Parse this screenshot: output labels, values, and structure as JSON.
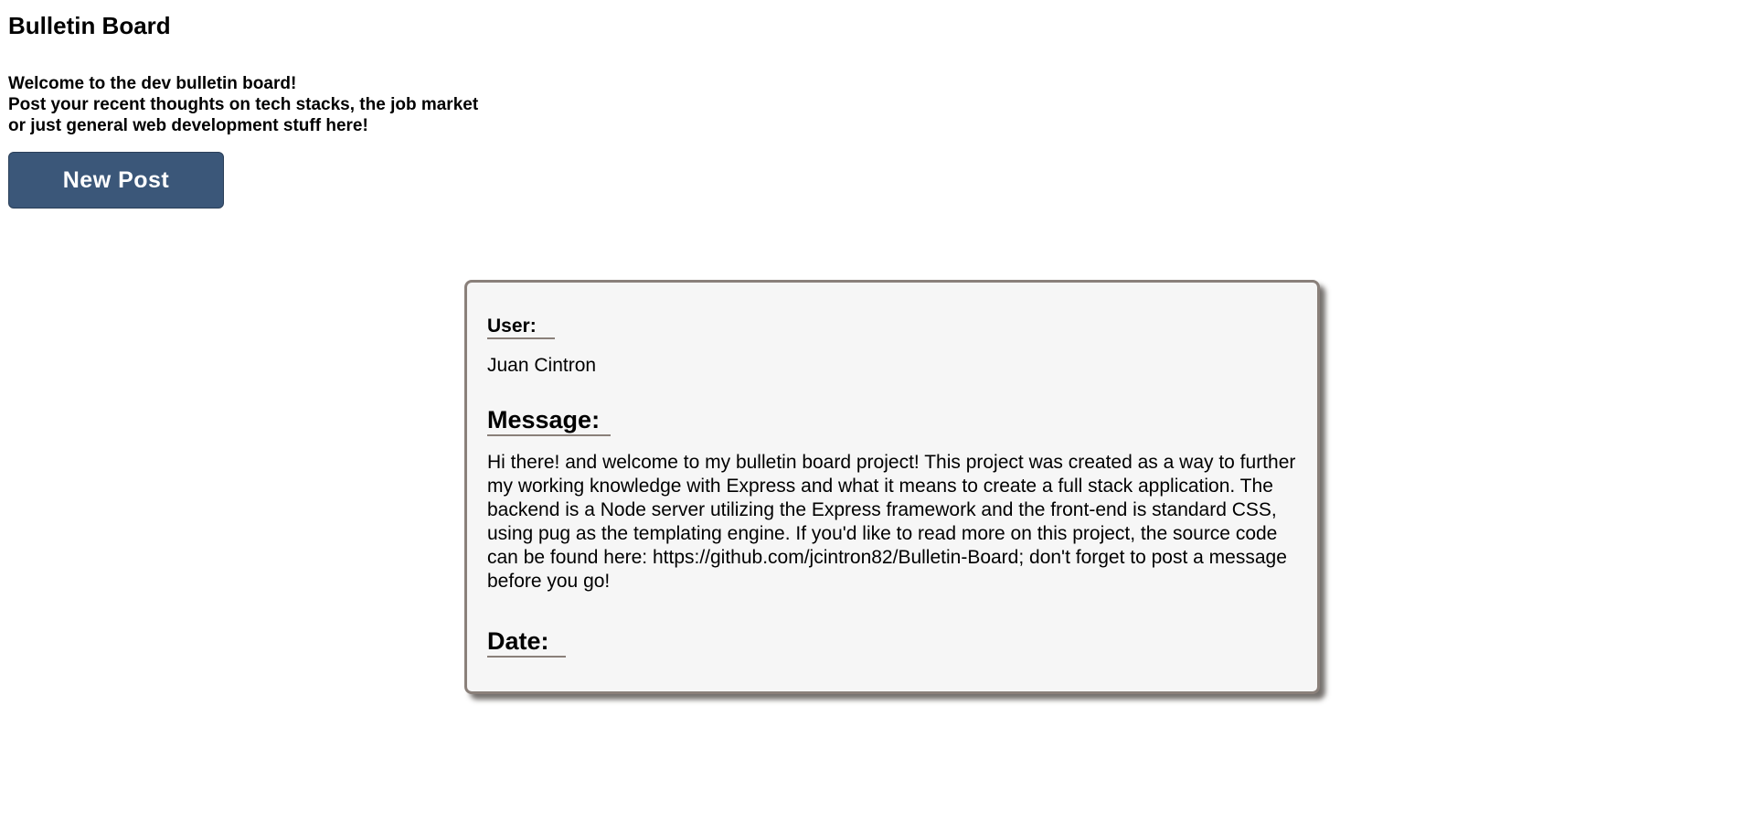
{
  "header": {
    "title": "Bulletin Board"
  },
  "intro": {
    "line1": "Welcome to the dev bulletin board!",
    "line2": "Post your recent thoughts on tech stacks, the job market",
    "line3": "or just general web development stuff here!"
  },
  "actions": {
    "new_post_label": "New Post"
  },
  "colors": {
    "button_bg": "#3b5779",
    "card_bg": "#f6f6f6",
    "card_border": "#8a807a"
  },
  "post": {
    "user_label": "User:",
    "user": "Juan Cintron",
    "message_label": "Message:",
    "message": "Hi there! and welcome to my bulletin board project! This project was created as a way to further my working knowledge with Express and what it means to create a full stack application. The backend is a Node server utilizing the Express framework and the front-end is standard CSS, using pug as the templating engine. If you'd like to read more on this project, the source code can be found here: https://github.com/jcintron82/Bulletin-Board; don't forget to post a message before you go!",
    "date_label": "Date:",
    "date": ""
  }
}
